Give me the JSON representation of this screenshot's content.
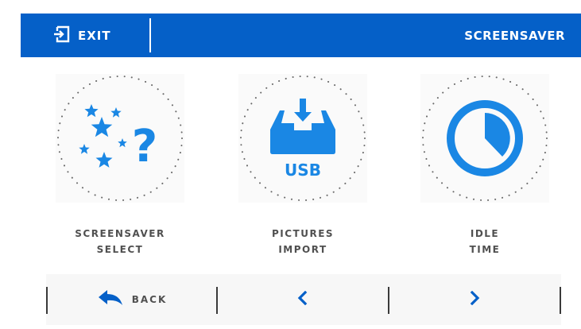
{
  "header": {
    "exit_label": "EXIT",
    "title": "SCREENSAVER"
  },
  "tiles": [
    {
      "icon": "stars-question-icon",
      "line1": "SCREENSAVER",
      "line2": "SELECT"
    },
    {
      "icon": "usb-import-tray-icon",
      "usb_text": "USB",
      "line1": "PICTURES",
      "line2": "IMPORT"
    },
    {
      "icon": "clock-timer-icon",
      "line1": "IDLE",
      "line2": "TIME"
    }
  ],
  "bottom_bar": {
    "back_label": "BACK",
    "prev_icon": "chevron-left-icon",
    "next_icon": "chevron-right-icon"
  },
  "colors": {
    "brand_blue": "#0560c8",
    "icon_blue": "#1a87e4",
    "label_gray": "#505050",
    "dots_gray": "#6a6a6a"
  }
}
